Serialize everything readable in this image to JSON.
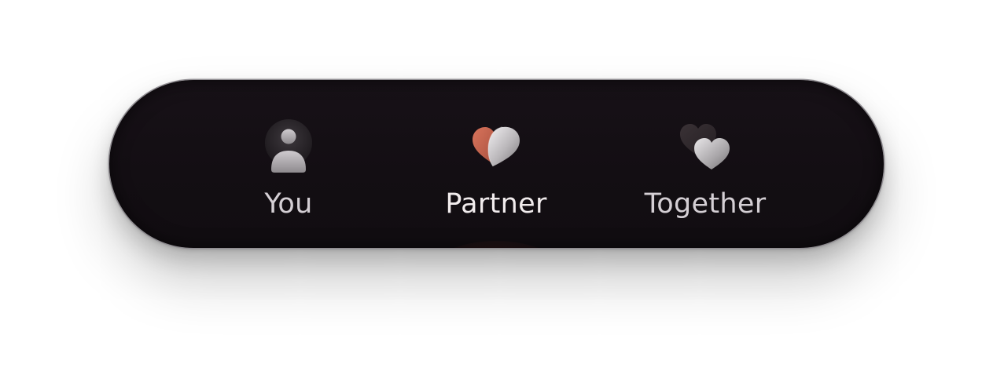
{
  "tabbar": {
    "active_tab": "partner",
    "accent_color": "#d66c52",
    "background_color": "#141014",
    "tabs": [
      {
        "id": "you",
        "label": "You",
        "icon": "person-icon"
      },
      {
        "id": "partner",
        "label": "Partner",
        "icon": "split-heart-icon"
      },
      {
        "id": "together",
        "label": "Together",
        "icon": "double-heart-icon"
      }
    ]
  }
}
